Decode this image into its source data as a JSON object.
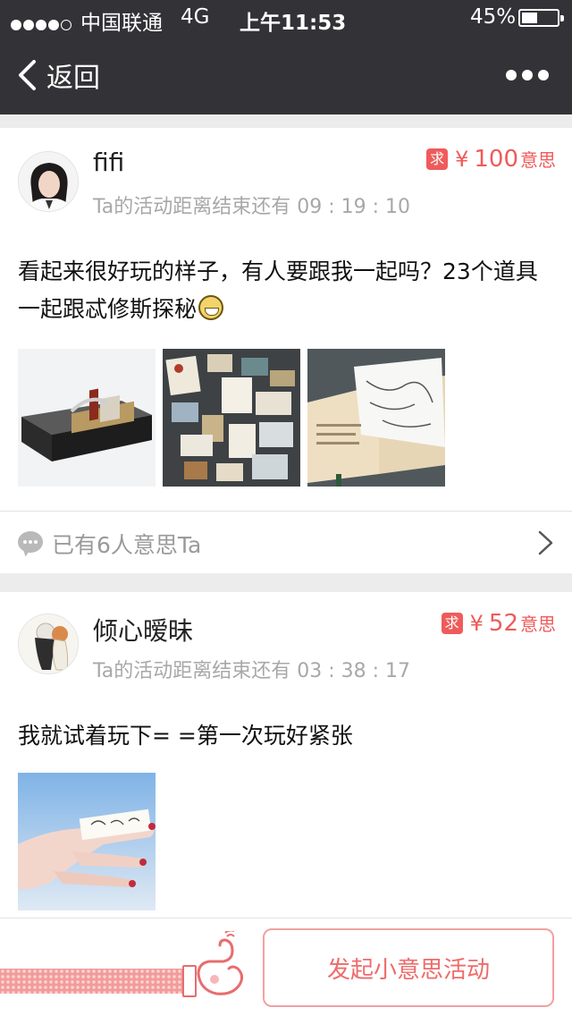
{
  "status_bar": {
    "carrier": "中国联通",
    "network": "4G",
    "time": "上午11:53",
    "battery": "45%",
    "battery_level": 0.45,
    "signal_bars": 4
  },
  "nav": {
    "back_label": "返回",
    "icons": [
      "chevron-left-icon",
      "more-icon"
    ]
  },
  "posts": [
    {
      "username": "fifi",
      "countdown": "Ta的活动距离结束还有 09 : 19 : 10",
      "reward_tag": "求",
      "reward_currency": "¥",
      "reward_amount": "100",
      "reward_unit": "意思",
      "text": "看起来很好玩的样子，有人要跟我一起吗？23个道具一起跟忒修斯探秘",
      "emoji": "grin-emoji-icon",
      "images": [
        "book-box-photo",
        "props-collage-photo",
        "open-book-map-photo"
      ],
      "comment_summary": "已有6人意思Ta"
    },
    {
      "username": "倾心暧昧",
      "countdown": "Ta的活动距离结束还有 03 : 38 : 17",
      "reward_tag": "求",
      "reward_currency": "¥",
      "reward_amount": "52",
      "reward_unit": "意思",
      "text": "我就试着玩下= =第一次玩好紧张",
      "images": [
        "hand-note-photo"
      ]
    }
  ],
  "bottom": {
    "start_button": "发起小意思活动"
  },
  "colors": {
    "header_bg": "#333337",
    "accent": "#ef5b5b",
    "page_bg": "#ececec"
  }
}
